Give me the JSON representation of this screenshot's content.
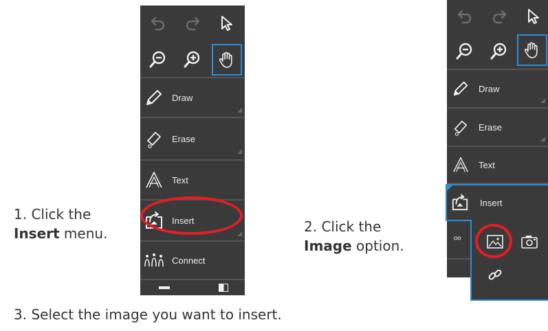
{
  "colors": {
    "panel_bg": "#3a3a3a",
    "separator": "#555555",
    "accent_blue": "#2c8fd6",
    "highlight_red": "#e31e24",
    "icon_disabled": "#6d6d6d",
    "icon_enabled": "#f0f0f0",
    "text": "#333333"
  },
  "toolbar_left": {
    "top_tools": [
      {
        "name": "undo",
        "icon": "undo-icon",
        "enabled": false
      },
      {
        "name": "redo",
        "icon": "redo-icon",
        "enabled": false
      },
      {
        "name": "select",
        "icon": "pointer-icon",
        "enabled": true
      },
      {
        "name": "zoom_out",
        "icon": "zoom-out-icon",
        "enabled": true
      },
      {
        "name": "zoom_in",
        "icon": "zoom-in-icon",
        "enabled": true
      },
      {
        "name": "pan",
        "icon": "hand-icon",
        "enabled": true,
        "selected": true
      }
    ],
    "menu": [
      {
        "label": "Draw",
        "icon": "pencil-icon"
      },
      {
        "label": "Erase",
        "icon": "eraser-icon"
      },
      {
        "label": "Text",
        "icon": "text-a-icon"
      },
      {
        "label": "Insert",
        "icon": "insert-icon"
      },
      {
        "label": "Connect",
        "icon": "connect-icon"
      }
    ]
  },
  "toolbar_right": {
    "menu": [
      {
        "label": "Draw",
        "icon": "pencil-icon"
      },
      {
        "label": "Erase",
        "icon": "eraser-icon"
      },
      {
        "label": "Text",
        "icon": "text-a-icon"
      },
      {
        "label": "Insert",
        "icon": "insert-icon"
      }
    ],
    "submenu": [
      {
        "name": "image",
        "icon": "image-icon"
      },
      {
        "name": "camera",
        "icon": "camera-icon"
      },
      {
        "name": "link",
        "icon": "link-icon"
      }
    ]
  },
  "captions": {
    "step1_line1": "1. Click the",
    "step1_bold": "Insert",
    "step1_rest": " menu.",
    "step2_line1": "2. Click the",
    "step2_bold": "Image",
    "step2_rest": " option.",
    "step3": "3. Select the image you want to insert."
  }
}
